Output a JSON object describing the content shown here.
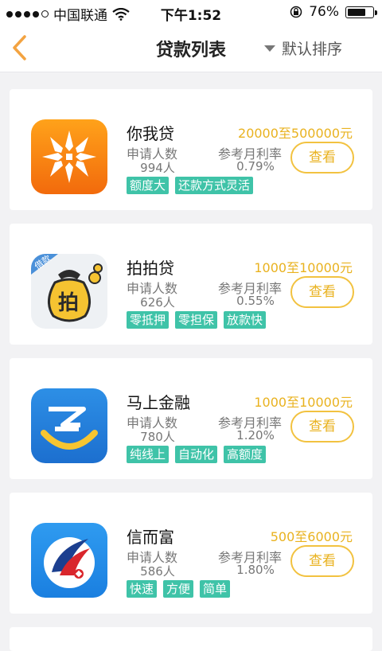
{
  "status": {
    "carrier": "中国联通",
    "time": "下午1:52",
    "battery": "76%",
    "battery_level": 0.76
  },
  "nav": {
    "title": "贷款列表",
    "sort_label": "默认排序"
  },
  "labels": {
    "applicants": "申请人数",
    "rate": "参考月利率",
    "view_button": "查看"
  },
  "loans": [
    {
      "name": "你我贷",
      "amount": "20000至500000元",
      "applicants": "994人",
      "rate": "0.79%",
      "tags": [
        "额度大",
        "还款方式灵活"
      ],
      "icon": "niwodai-logo-icon"
    },
    {
      "name": "拍拍贷",
      "amount": "1000至10000元",
      "applicants": "626人",
      "rate": "0.55%",
      "tags": [
        "零抵押",
        "零担保",
        "放款快"
      ],
      "icon": "paipaidai-moneybag-icon"
    },
    {
      "name": "马上金融",
      "amount": "1000至10000元",
      "applicants": "780人",
      "rate": "1.20%",
      "tags": [
        "纯线上",
        "自动化",
        "高额度"
      ],
      "icon": "mashang-logo-icon"
    },
    {
      "name": "信而富",
      "amount": "500至6000元",
      "applicants": "586人",
      "rate": "1.80%",
      "tags": [
        "快速",
        "方便",
        "简单"
      ],
      "icon": "xinerfu-logo-icon"
    }
  ],
  "logo_text": {
    "paipaidai_badge": "借款",
    "paipaidai_char": "拍"
  },
  "colors": {
    "accent_gold": "#e9b21f",
    "tag_green": "#3fc3a8",
    "back_orange": "#f3a341"
  }
}
